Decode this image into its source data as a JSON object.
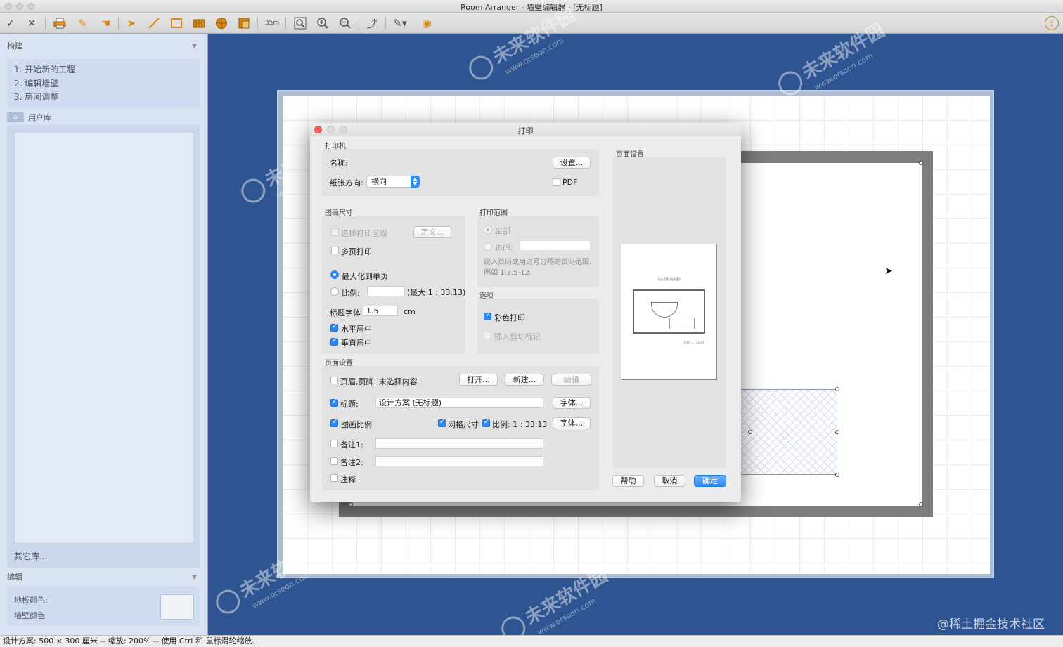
{
  "window": {
    "title": "Room Arranger - 墙壁编辑器 - [无标题]"
  },
  "sidebar": {
    "build_header": "构建",
    "steps": [
      "1. 开始新的工程",
      "2. 编辑墙壁",
      "3. 房间调整"
    ],
    "library_label": "用户库",
    "other_library": "其它库...",
    "edit_header": "编辑",
    "floor_color_label": "地板颜色:",
    "wall_color_label": "墙壁颜色"
  },
  "dialog": {
    "title": "打印",
    "printer": {
      "group": "打印机",
      "name_label": "名称:",
      "setup_button": "设置...",
      "orientation_label": "纸张方向:",
      "orientation_value": "横向",
      "pdf_label": "PDF",
      "pdf_checked": false
    },
    "drawing_size": {
      "group": "图画尺寸",
      "select_area_label": "选择打印区域",
      "define_button": "定义...",
      "multi_page_label": "多页打印",
      "maximize_label": "最大化到单页",
      "scale_label": "比例:",
      "scale_max": "(最大 1 : 33.13)",
      "title_font_label": "标题字体",
      "title_font_value": "1.5",
      "title_font_unit": "cm",
      "h_center_label": "水平居中",
      "v_center_label": "垂直居中"
    },
    "print_range": {
      "group": "打印范围",
      "all_label": "全部",
      "pages_label": "页码:",
      "pages_hint": "键入页码或用逗号分隔的页码范围. 例如 1,3,5-12."
    },
    "options": {
      "group": "选项",
      "color_print_label": "彩色打印",
      "crop_marks_label": "插入剪切标记"
    },
    "page_setup": {
      "group": "页面设置",
      "header_footer_label": "页眉,页脚: 未选择内容",
      "open_button": "打开...",
      "new_button": "新建...",
      "edit_button": "编辑",
      "title_label": "标题:",
      "title_value": "设计方案 (无标题)",
      "font_button": "字体...",
      "drawing_scale_label": "图画比例",
      "grid_size_label": "网格尺寸",
      "ratio_label": "比例: 1 : 33.13",
      "font_button_2": "字体...",
      "note1_label": "备注1:",
      "note2_label": "备注2:",
      "comment_label": "注释"
    },
    "preview": {
      "group": "页面设置",
      "page_title": "设计方案 (无标题)"
    },
    "buttons": {
      "help": "帮助",
      "cancel": "取消",
      "ok": "确定"
    }
  },
  "statusbar": {
    "text": "设计方案: 500 × 300 厘米 -- 缩放: 200% -- 使用 Ctrl 和 鼠标滑轮缩放."
  },
  "watermark": {
    "brand": "未来软件园",
    "url": "www.orsoon.com",
    "credit": "@稀土掘金技术社区"
  },
  "colors": {
    "accent": "#2d89f2",
    "desktop": "#2e5591",
    "wall": "#7d7d7d",
    "close": "#fc5f57"
  }
}
